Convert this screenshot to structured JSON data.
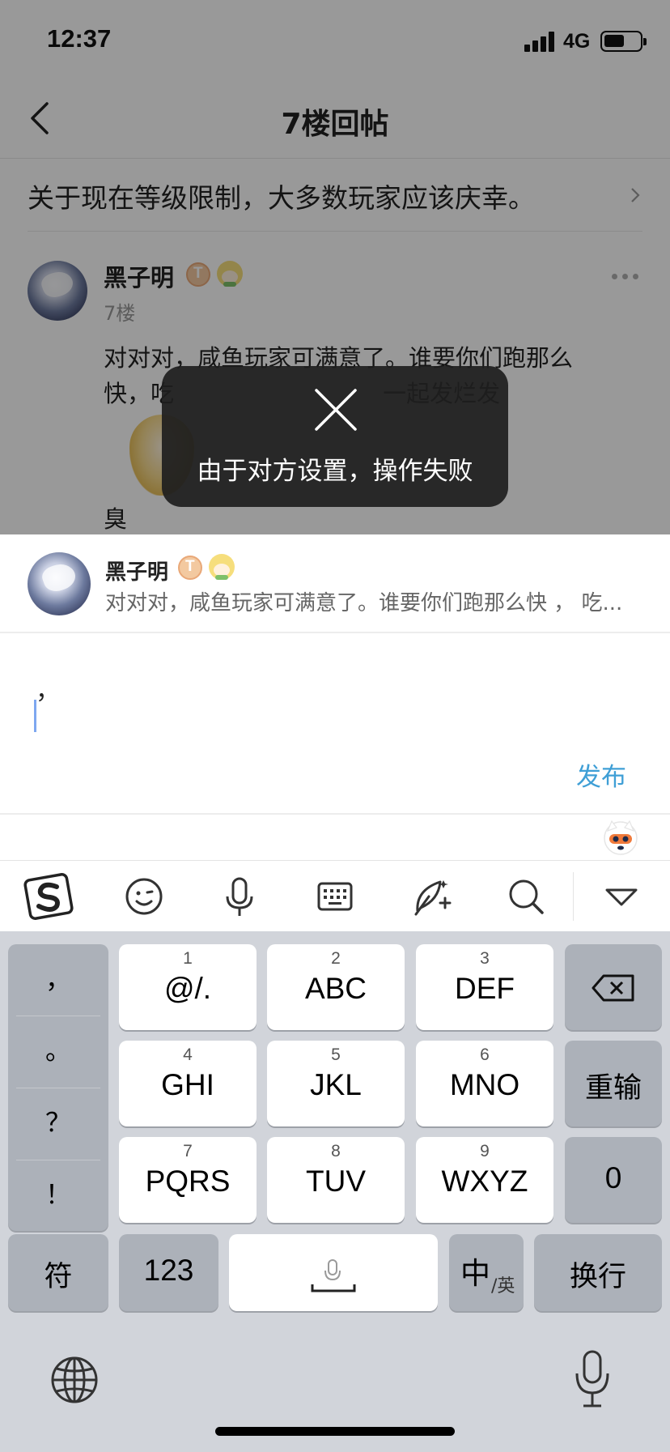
{
  "status_bar": {
    "time": "12:37",
    "network": "4G"
  },
  "nav": {
    "title": "7楼回帖"
  },
  "thread": {
    "title": "关于现在等级限制，大多数玩家应该庆幸。"
  },
  "post": {
    "author": "黑子明",
    "floor": "7楼",
    "body_line1": "对对对，咸鱼玩家可满意了。谁要你们跑那么",
    "body_line2": "快，吃                            一起发烂发",
    "body_tail": "臭"
  },
  "toast": {
    "message": "由于对方设置，操作失败",
    "icon": "close-icon"
  },
  "reply": {
    "quote_author": "黑子明",
    "quote_text": "对对对，咸鱼玩家可满意了。谁要你们跑那么快 ， 吃...",
    "input_value": "，",
    "publish_label": "发布"
  },
  "toolbar": {
    "icons": [
      "sogou-logo-icon",
      "emoji-icon",
      "voice-icon",
      "keyboard-icon",
      "quill-icon",
      "search-icon",
      "collapse-icon"
    ]
  },
  "keyboard": {
    "punct": [
      "，",
      "。",
      "？",
      "！"
    ],
    "keys": [
      {
        "num": "1",
        "label": "@/."
      },
      {
        "num": "2",
        "label": "ABC"
      },
      {
        "num": "3",
        "label": "DEF"
      },
      {
        "num": "4",
        "label": "GHI"
      },
      {
        "num": "5",
        "label": "JKL"
      },
      {
        "num": "6",
        "label": "MNO"
      },
      {
        "num": "7",
        "label": "PQRS"
      },
      {
        "num": "8",
        "label": "TUV"
      },
      {
        "num": "9",
        "label": "WXYZ"
      }
    ],
    "reinput": "重输",
    "zero": "0",
    "symbols": "符",
    "numbers": "123",
    "zh": "中",
    "en": "/英",
    "newline": "换行"
  },
  "colors": {
    "accent": "#3f9fd6",
    "toast_bg": "#1e1e1e",
    "keyboard_bg": "#d1d4da",
    "dark_key": "#acb1b9"
  }
}
